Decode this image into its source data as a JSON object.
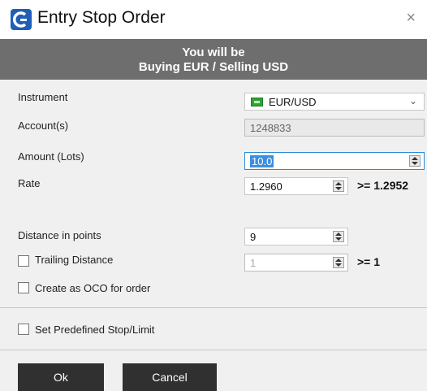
{
  "window": {
    "title": "Entry Stop Order",
    "close_glyph": "×",
    "icon": "app-logo-icon"
  },
  "banner": {
    "line1": "You will be",
    "line2": "Buying EUR / Selling USD"
  },
  "form": {
    "instrument": {
      "label": "Instrument",
      "value": "EUR/USD",
      "icon": "eurusd-flag-icon"
    },
    "accounts": {
      "label": "Account(s)",
      "value": "1248833"
    },
    "amount": {
      "label": "Amount (Lots)",
      "value": "10.0"
    },
    "rate": {
      "label": "Rate",
      "value": "1.2960",
      "constraint": ">=  1.2952"
    },
    "distance": {
      "label": "Distance in points",
      "value": "9"
    },
    "trailing": {
      "label": "Trailing Distance",
      "value": "1",
      "constraint": ">=  1",
      "checked": false
    },
    "oco": {
      "label": "Create as OCO for order",
      "checked": false
    },
    "predefined": {
      "label": "Set Predefined Stop/Limit",
      "checked": false
    }
  },
  "buttons": {
    "ok": "Ok",
    "cancel": "Cancel"
  },
  "colors": {
    "banner_bg": "#6e6e6e",
    "button_bg": "#303030",
    "focus_border": "#2a8bd6"
  }
}
